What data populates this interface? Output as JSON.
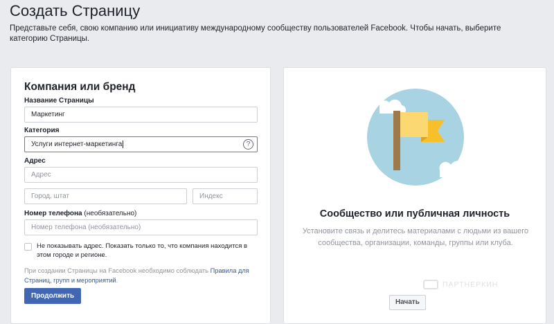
{
  "header": {
    "title": "Создать Страницу",
    "description": "Представьте себя, свою компанию или инициативу международному сообществу пользователей Facebook. Чтобы начать, выберите категорию Страницы."
  },
  "business_card": {
    "title": "Компания или бренд",
    "page_name": {
      "label": "Название Страницы",
      "value": "Маркетинг"
    },
    "category": {
      "label": "Категория",
      "value": "Услуги интернет-маркетинга",
      "help_icon": "?"
    },
    "address": {
      "label": "Адрес",
      "street_placeholder": "Адрес",
      "city_placeholder": "Город, штат",
      "zip_placeholder": "Индекс"
    },
    "phone": {
      "label": "Номер телефона",
      "label_optional": "(необязательно)",
      "placeholder": "Номер телефона (необязательно)"
    },
    "hide_address_label": "Не показывать адрес. Показать только то, что компания находится в этом городе и регионе.",
    "terms_text": "При создании Страницы на Facebook необходимо соблюдать",
    "terms_link": "Правила для Страниц, групп и мероприятий",
    "terms_end": ".",
    "continue_button": "Продолжить"
  },
  "community_card": {
    "title": "Сообщество или публичная личность",
    "description": "Установите связь и делитесь материалами с людьми из вашего сообщества, организации, команды, группы или клуба.",
    "start_button": "Начать",
    "illustration_icon": "flag-icon"
  },
  "watermark": {
    "text": "ПАРТНЕРКИН"
  },
  "colors": {
    "background": "#e9ebee",
    "primary_button": "#4267b2",
    "link": "#365899",
    "focus_border": "#4080ff",
    "flag_yellow": "#fcd872",
    "flag_dark_yellow": "#f7c02b",
    "flag_pole": "#9e7a4a",
    "circle_bg": "#a8d3e3"
  }
}
